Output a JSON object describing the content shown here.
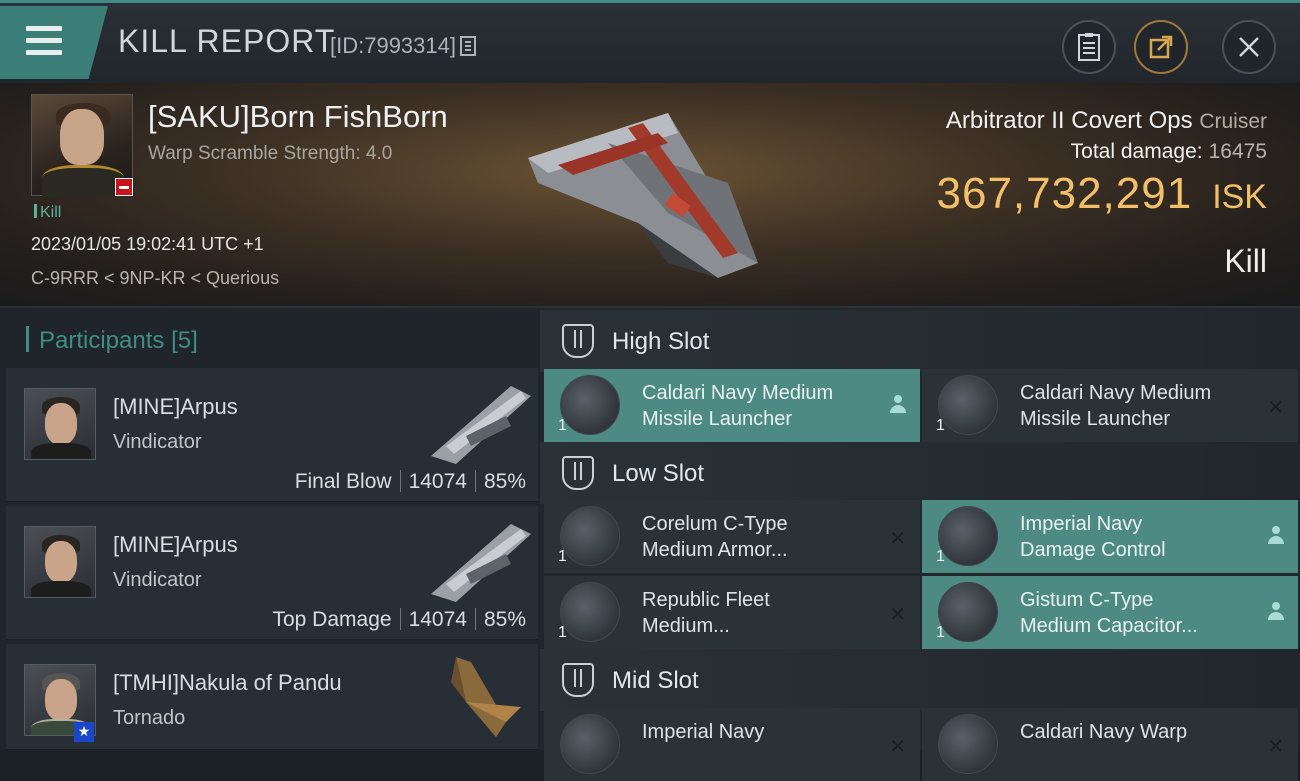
{
  "header": {
    "title": "KILL REPORT",
    "report_id": "[ID:7993314]",
    "buttons": [
      "clipboard",
      "share",
      "close"
    ]
  },
  "victim": {
    "name": "[SAKU]Born FishBorn",
    "warp_scramble": "Warp Scramble Strength: 4.0",
    "tag": "Kill",
    "datetime": "2023/01/05 19:02:41 UTC +1",
    "location": "C-9RRR < 9NP-KR < Querious",
    "ship_name": "Arbitrator II Covert Ops",
    "ship_class": "Cruiser",
    "total_damage_label": "Total damage:",
    "total_damage_value": "16475",
    "isk_value": "367,732,291",
    "isk_unit": "ISK",
    "result": "Kill"
  },
  "participants": {
    "label": "Participants",
    "count": "[5]",
    "items": [
      {
        "name": "[MINE]Arpus",
        "ship": "Vindicator",
        "role": "Final Blow",
        "damage": "14074",
        "percent": "85%"
      },
      {
        "name": "[MINE]Arpus",
        "ship": "Vindicator",
        "role": "Top Damage",
        "damage": "14074",
        "percent": "85%"
      },
      {
        "name": "[TMHI]Nakula of Pandu",
        "ship": "Tornado",
        "role": "",
        "damage": "",
        "percent": ""
      }
    ]
  },
  "fitting": {
    "high_slot": {
      "title": "High Slot",
      "modules": [
        {
          "line1": "Caldari Navy Medium",
          "line2": "Missile Launcher",
          "qty": "1",
          "status": "person"
        },
        {
          "line1": "Caldari Navy Medium",
          "line2": "Missile Launcher",
          "qty": "1",
          "status": "x"
        }
      ]
    },
    "low_slot": {
      "title": "Low Slot",
      "modules": [
        {
          "line1": "Corelum C-Type",
          "line2": "Medium Armor...",
          "qty": "1",
          "status": "x"
        },
        {
          "line1": "Imperial Navy",
          "line2": "Damage Control",
          "qty": "1",
          "status": "person"
        },
        {
          "line1": "Republic Fleet",
          "line2": "Medium...",
          "qty": "1",
          "status": "x"
        },
        {
          "line1": "Gistum C-Type",
          "line2": "Medium Capacitor...",
          "qty": "1",
          "status": "person"
        }
      ]
    },
    "mid_slot": {
      "title": "Mid Slot",
      "modules": [
        {
          "line1": "Imperial Navy",
          "line2": "",
          "qty": "",
          "status": "x"
        },
        {
          "line1": "Caldari Navy Warp",
          "line2": "",
          "qty": "",
          "status": "x"
        }
      ]
    }
  }
}
